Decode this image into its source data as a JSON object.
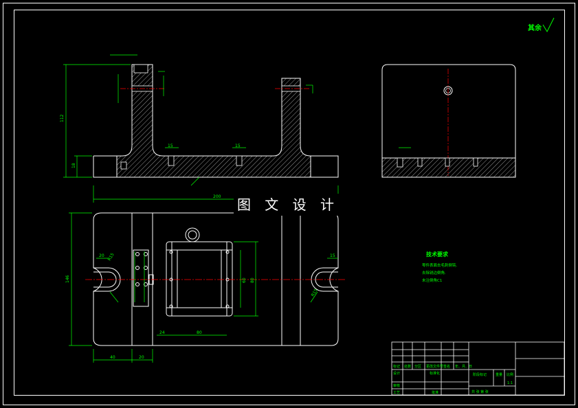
{
  "watermark": "图 文 设 计",
  "roughness_note": "其余",
  "tech_requirements": {
    "title": "技术要求",
    "lines": [
      "零件表面去毛刺倒钝.",
      "去除锐边倒角.",
      "未注倒角C1"
    ]
  },
  "dimensions": {
    "front_height": "112",
    "front_base": "18",
    "front_width": "200",
    "slot_left": "15",
    "slot_right": "15",
    "plan_height": "146",
    "plan_left_a": "40",
    "plan_left_b": "20",
    "plan_mid_a": "24",
    "plan_mid_b": "80",
    "plan_inner": "80",
    "plan_inner2": "60",
    "notch_left": "R15",
    "notch_right": "R15",
    "notch_w_left": "20",
    "notch_w_right": "15"
  },
  "title_block": {
    "header_cells": [
      "标记",
      "处数",
      "分区",
      "更改文件号",
      "签名",
      "年、月、日"
    ],
    "row_labels": [
      "设计",
      "审核",
      "工艺"
    ],
    "std_label": "标准化",
    "approve_label": "批准",
    "stage_label": "阶段标记",
    "weight_label": "重量",
    "scale_label": "比例",
    "scale_value": "1:1",
    "sheets_label": "共   张  第   张"
  },
  "colors": {
    "background": "#000000",
    "outline": "#ffffff",
    "dimension": "#00ff00",
    "hatch": "#ffffff",
    "centerline": "#ff0000",
    "text_green": "#00ff00"
  }
}
